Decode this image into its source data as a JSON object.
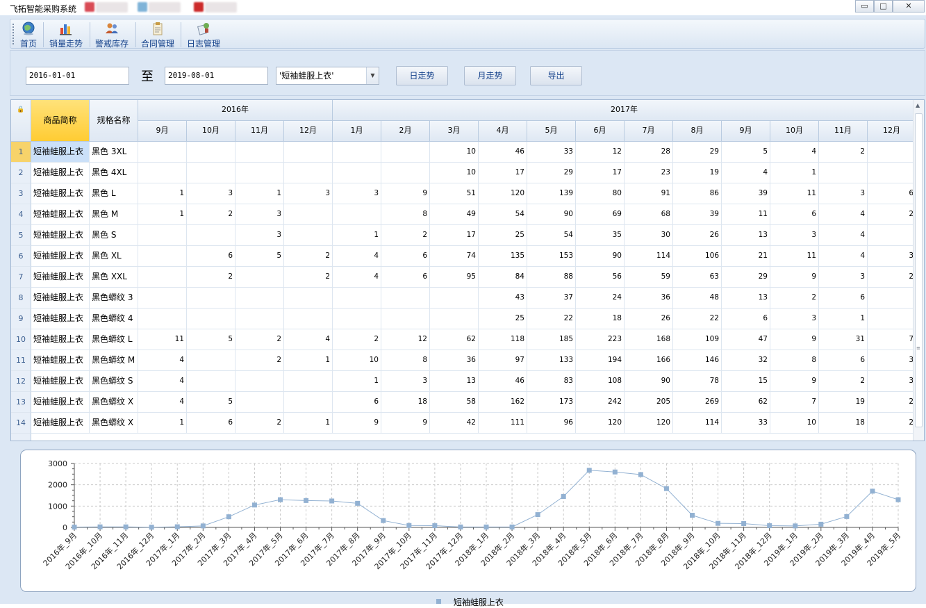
{
  "window": {
    "title": "飞拓智能采购系统",
    "controls": {
      "minimize": "▭",
      "maximize": "□",
      "close": "✕"
    }
  },
  "toolbar": {
    "items": [
      {
        "label": "首页",
        "icon": "globe-home-icon"
      },
      {
        "label": "销量走势",
        "icon": "bar-chart-icon"
      },
      {
        "label": "警戒库存",
        "icon": "users-icon"
      },
      {
        "label": "合同管理",
        "icon": "clipboard-icon"
      },
      {
        "label": "日志管理",
        "icon": "log-icon"
      }
    ]
  },
  "filter": {
    "start_date": "2016-01-01",
    "to_label": "至",
    "end_date": "2019-08-01",
    "product": "'短袖蛙服上衣'",
    "day_trend_button": "日走势",
    "month_trend_button": "月走势",
    "export_button": "导出"
  },
  "grid": {
    "corner_icon": "lock-icon",
    "col_product": "商品简称",
    "col_spec": "规格名称",
    "year_headers": [
      "2016年",
      "2017年"
    ],
    "month_headers": [
      "9月",
      "10月",
      "11月",
      "12月",
      "1月",
      "2月",
      "3月",
      "4月",
      "5月",
      "6月",
      "7月",
      "8月",
      "9月",
      "10月",
      "11月",
      "12月"
    ],
    "rows": [
      {
        "n": "1",
        "product": "短袖蛙服上衣",
        "spec": "黑色 3XL",
        "values": [
          "",
          "",
          "",
          "",
          "",
          "",
          "10",
          "46",
          "33",
          "12",
          "28",
          "29",
          "5",
          "4",
          "2",
          ""
        ]
      },
      {
        "n": "2",
        "product": "短袖蛙服上衣",
        "spec": "黑色 4XL",
        "values": [
          "",
          "",
          "",
          "",
          "",
          "",
          "10",
          "17",
          "29",
          "17",
          "23",
          "19",
          "4",
          "1",
          "",
          ""
        ]
      },
      {
        "n": "3",
        "product": "短袖蛙服上衣",
        "spec": "黑色 L",
        "values": [
          "1",
          "3",
          "1",
          "3",
          "3",
          "9",
          "51",
          "120",
          "139",
          "80",
          "91",
          "86",
          "39",
          "11",
          "3",
          "6"
        ]
      },
      {
        "n": "4",
        "product": "短袖蛙服上衣",
        "spec": "黑色 M",
        "values": [
          "1",
          "2",
          "3",
          "",
          "",
          "8",
          "49",
          "54",
          "90",
          "69",
          "68",
          "39",
          "11",
          "6",
          "4",
          "2"
        ]
      },
      {
        "n": "5",
        "product": "短袖蛙服上衣",
        "spec": "黑色 S",
        "values": [
          "",
          "",
          "3",
          "",
          "1",
          "2",
          "17",
          "25",
          "54",
          "35",
          "30",
          "26",
          "13",
          "3",
          "4",
          ""
        ]
      },
      {
        "n": "6",
        "product": "短袖蛙服上衣",
        "spec": "黑色 XL",
        "values": [
          "",
          "6",
          "5",
          "2",
          "4",
          "6",
          "74",
          "135",
          "153",
          "90",
          "114",
          "106",
          "21",
          "11",
          "4",
          "3"
        ]
      },
      {
        "n": "7",
        "product": "短袖蛙服上衣",
        "spec": "黑色 XXL",
        "values": [
          "",
          "2",
          "",
          "2",
          "4",
          "6",
          "95",
          "84",
          "88",
          "56",
          "59",
          "63",
          "29",
          "9",
          "3",
          "2"
        ]
      },
      {
        "n": "8",
        "product": "短袖蛙服上衣",
        "spec": "黑色蟒纹 3",
        "values": [
          "",
          "",
          "",
          "",
          "",
          "",
          "",
          "43",
          "37",
          "24",
          "36",
          "48",
          "13",
          "2",
          "6",
          ""
        ]
      },
      {
        "n": "9",
        "product": "短袖蛙服上衣",
        "spec": "黑色蟒纹 4",
        "values": [
          "",
          "",
          "",
          "",
          "",
          "",
          "",
          "25",
          "22",
          "18",
          "26",
          "22",
          "6",
          "3",
          "1",
          ""
        ]
      },
      {
        "n": "10",
        "product": "短袖蛙服上衣",
        "spec": "黑色蟒纹 L",
        "values": [
          "11",
          "5",
          "2",
          "4",
          "2",
          "12",
          "62",
          "118",
          "185",
          "223",
          "168",
          "109",
          "47",
          "9",
          "31",
          "7"
        ]
      },
      {
        "n": "11",
        "product": "短袖蛙服上衣",
        "spec": "黑色蟒纹 M",
        "values": [
          "4",
          "",
          "2",
          "1",
          "10",
          "8",
          "36",
          "97",
          "133",
          "194",
          "166",
          "146",
          "32",
          "8",
          "6",
          "3"
        ]
      },
      {
        "n": "12",
        "product": "短袖蛙服上衣",
        "spec": "黑色蟒纹 S",
        "values": [
          "4",
          "",
          "",
          "",
          "1",
          "3",
          "13",
          "46",
          "83",
          "108",
          "90",
          "78",
          "15",
          "9",
          "2",
          "3"
        ]
      },
      {
        "n": "13",
        "product": "短袖蛙服上衣",
        "spec": "黑色蟒纹 X",
        "values": [
          "4",
          "5",
          "",
          "",
          "6",
          "18",
          "58",
          "162",
          "173",
          "242",
          "205",
          "269",
          "62",
          "7",
          "19",
          "2"
        ]
      },
      {
        "n": "14",
        "product": "短袖蛙服上衣",
        "spec": "黑色蟒纹 X",
        "values": [
          "1",
          "6",
          "2",
          "1",
          "9",
          "9",
          "42",
          "111",
          "96",
          "120",
          "120",
          "114",
          "33",
          "10",
          "18",
          "2"
        ]
      }
    ]
  },
  "colors": {
    "series": "#92b1d2",
    "selected_row_header": "#f7d36a",
    "frozen_header": "#ffd24d"
  },
  "chart_data": {
    "type": "line",
    "x": [
      "2016年_9月",
      "2016年_10月",
      "2016年_11月",
      "2016年_12月",
      "2017年_1月",
      "2017年_2月",
      "2017年_3月",
      "2017年_4月",
      "2017年_5月",
      "2017年_6月",
      "2017年_7月",
      "2017年_8月",
      "2017年_9月",
      "2017年_10月",
      "2017年_11月",
      "2017年_12月",
      "2018年_1月",
      "2018年_2月",
      "2018年_3月",
      "2018年_4月",
      "2018年_5月",
      "2018年_6月",
      "2018年_7月",
      "2018年_8月",
      "2018年_9月",
      "2018年_10月",
      "2018年_11月",
      "2018年_12月",
      "2019年_1月",
      "2019年_2月",
      "2019年_3月",
      "2019年_4月",
      "2019年_5月"
    ],
    "series": [
      {
        "name": "短袖蛙服上衣",
        "values": [
          15,
          25,
          25,
          10,
          30,
          70,
          500,
          1050,
          1300,
          1260,
          1240,
          1130,
          320,
          90,
          80,
          20,
          20,
          20,
          600,
          1450,
          2680,
          2600,
          2480,
          1820,
          570,
          190,
          180,
          80,
          70,
          150,
          510,
          1700,
          1300
        ]
      }
    ],
    "yticks": [
      "0",
      "1000",
      "2000",
      "3000"
    ],
    "ylim": [
      0,
      3000
    ],
    "grid": true,
    "legend": "bottom"
  }
}
